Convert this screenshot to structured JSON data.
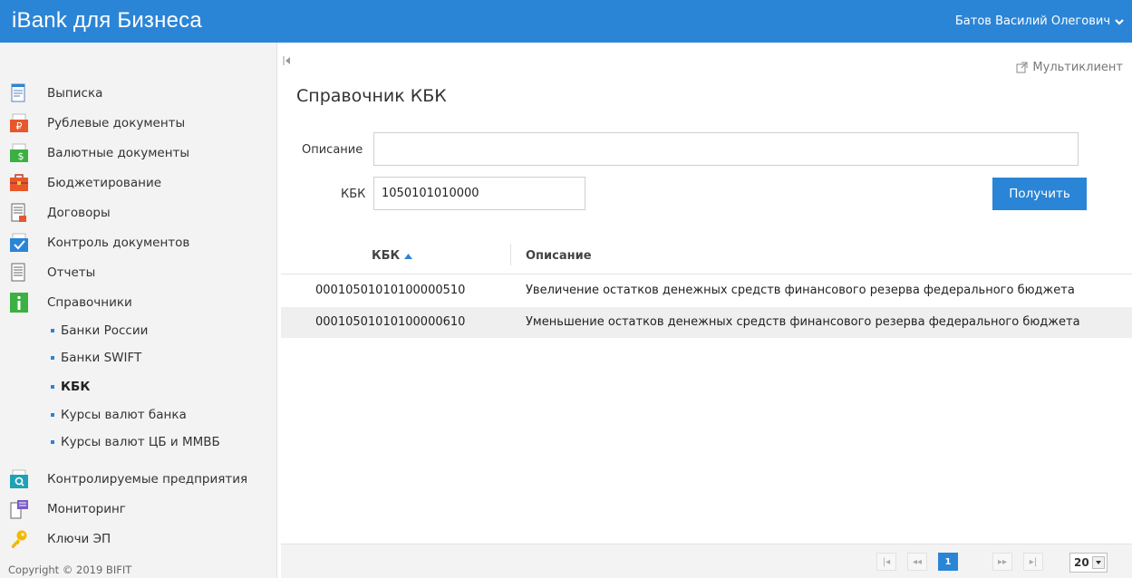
{
  "header": {
    "app_title": "iBank для Бизнеса",
    "user_name": "Батов Василий Олегович",
    "accent": "#2b85d6"
  },
  "sidebar": {
    "items": [
      {
        "label": "Выписка",
        "icon": "statement-icon"
      },
      {
        "label": "Рублевые документы",
        "icon": "ruble-docs-icon"
      },
      {
        "label": "Валютные документы",
        "icon": "currency-docs-icon"
      },
      {
        "label": "Бюджетирование",
        "icon": "budget-icon"
      },
      {
        "label": "Договоры",
        "icon": "contracts-icon"
      },
      {
        "label": "Контроль документов",
        "icon": "doc-control-icon"
      },
      {
        "label": "Отчеты",
        "icon": "reports-icon"
      },
      {
        "label": "Справочники",
        "icon": "info-icon"
      }
    ],
    "subitems": [
      {
        "label": "Банки России"
      },
      {
        "label": "Банки SWIFT"
      },
      {
        "label": "КБК"
      },
      {
        "label": "Курсы валют банка"
      },
      {
        "label": "Курсы валют ЦБ и ММВБ"
      }
    ],
    "items_after": [
      {
        "label": "Контролируемые предприятия",
        "icon": "controlled-companies-icon"
      },
      {
        "label": "Мониторинг",
        "icon": "monitoring-icon"
      },
      {
        "label": "Ключи ЭП",
        "icon": "key-icon"
      }
    ],
    "copyright": "Copyright © 2019 BIFIT"
  },
  "main": {
    "multiclient_label": "Мультиклиент",
    "page_title": "Справочник КБК",
    "form": {
      "description_label": "Описание",
      "description_value": "",
      "kbk_label": "КБК",
      "kbk_value": "1050101010000",
      "submit_label": "Получить"
    },
    "table": {
      "columns": [
        "КБК",
        "Описание"
      ],
      "sort": "ascending",
      "rows": [
        {
          "kbk": "00010501010100000510",
          "description": "Увеличение остатков денежных средств финансового резерва федерального бюджета"
        },
        {
          "kbk": "00010501010100000610",
          "description": "Уменьшение остатков денежных средств финансового резерва федерального бюджета"
        }
      ]
    },
    "pager": {
      "current_page": "1",
      "page_size": "20"
    }
  }
}
